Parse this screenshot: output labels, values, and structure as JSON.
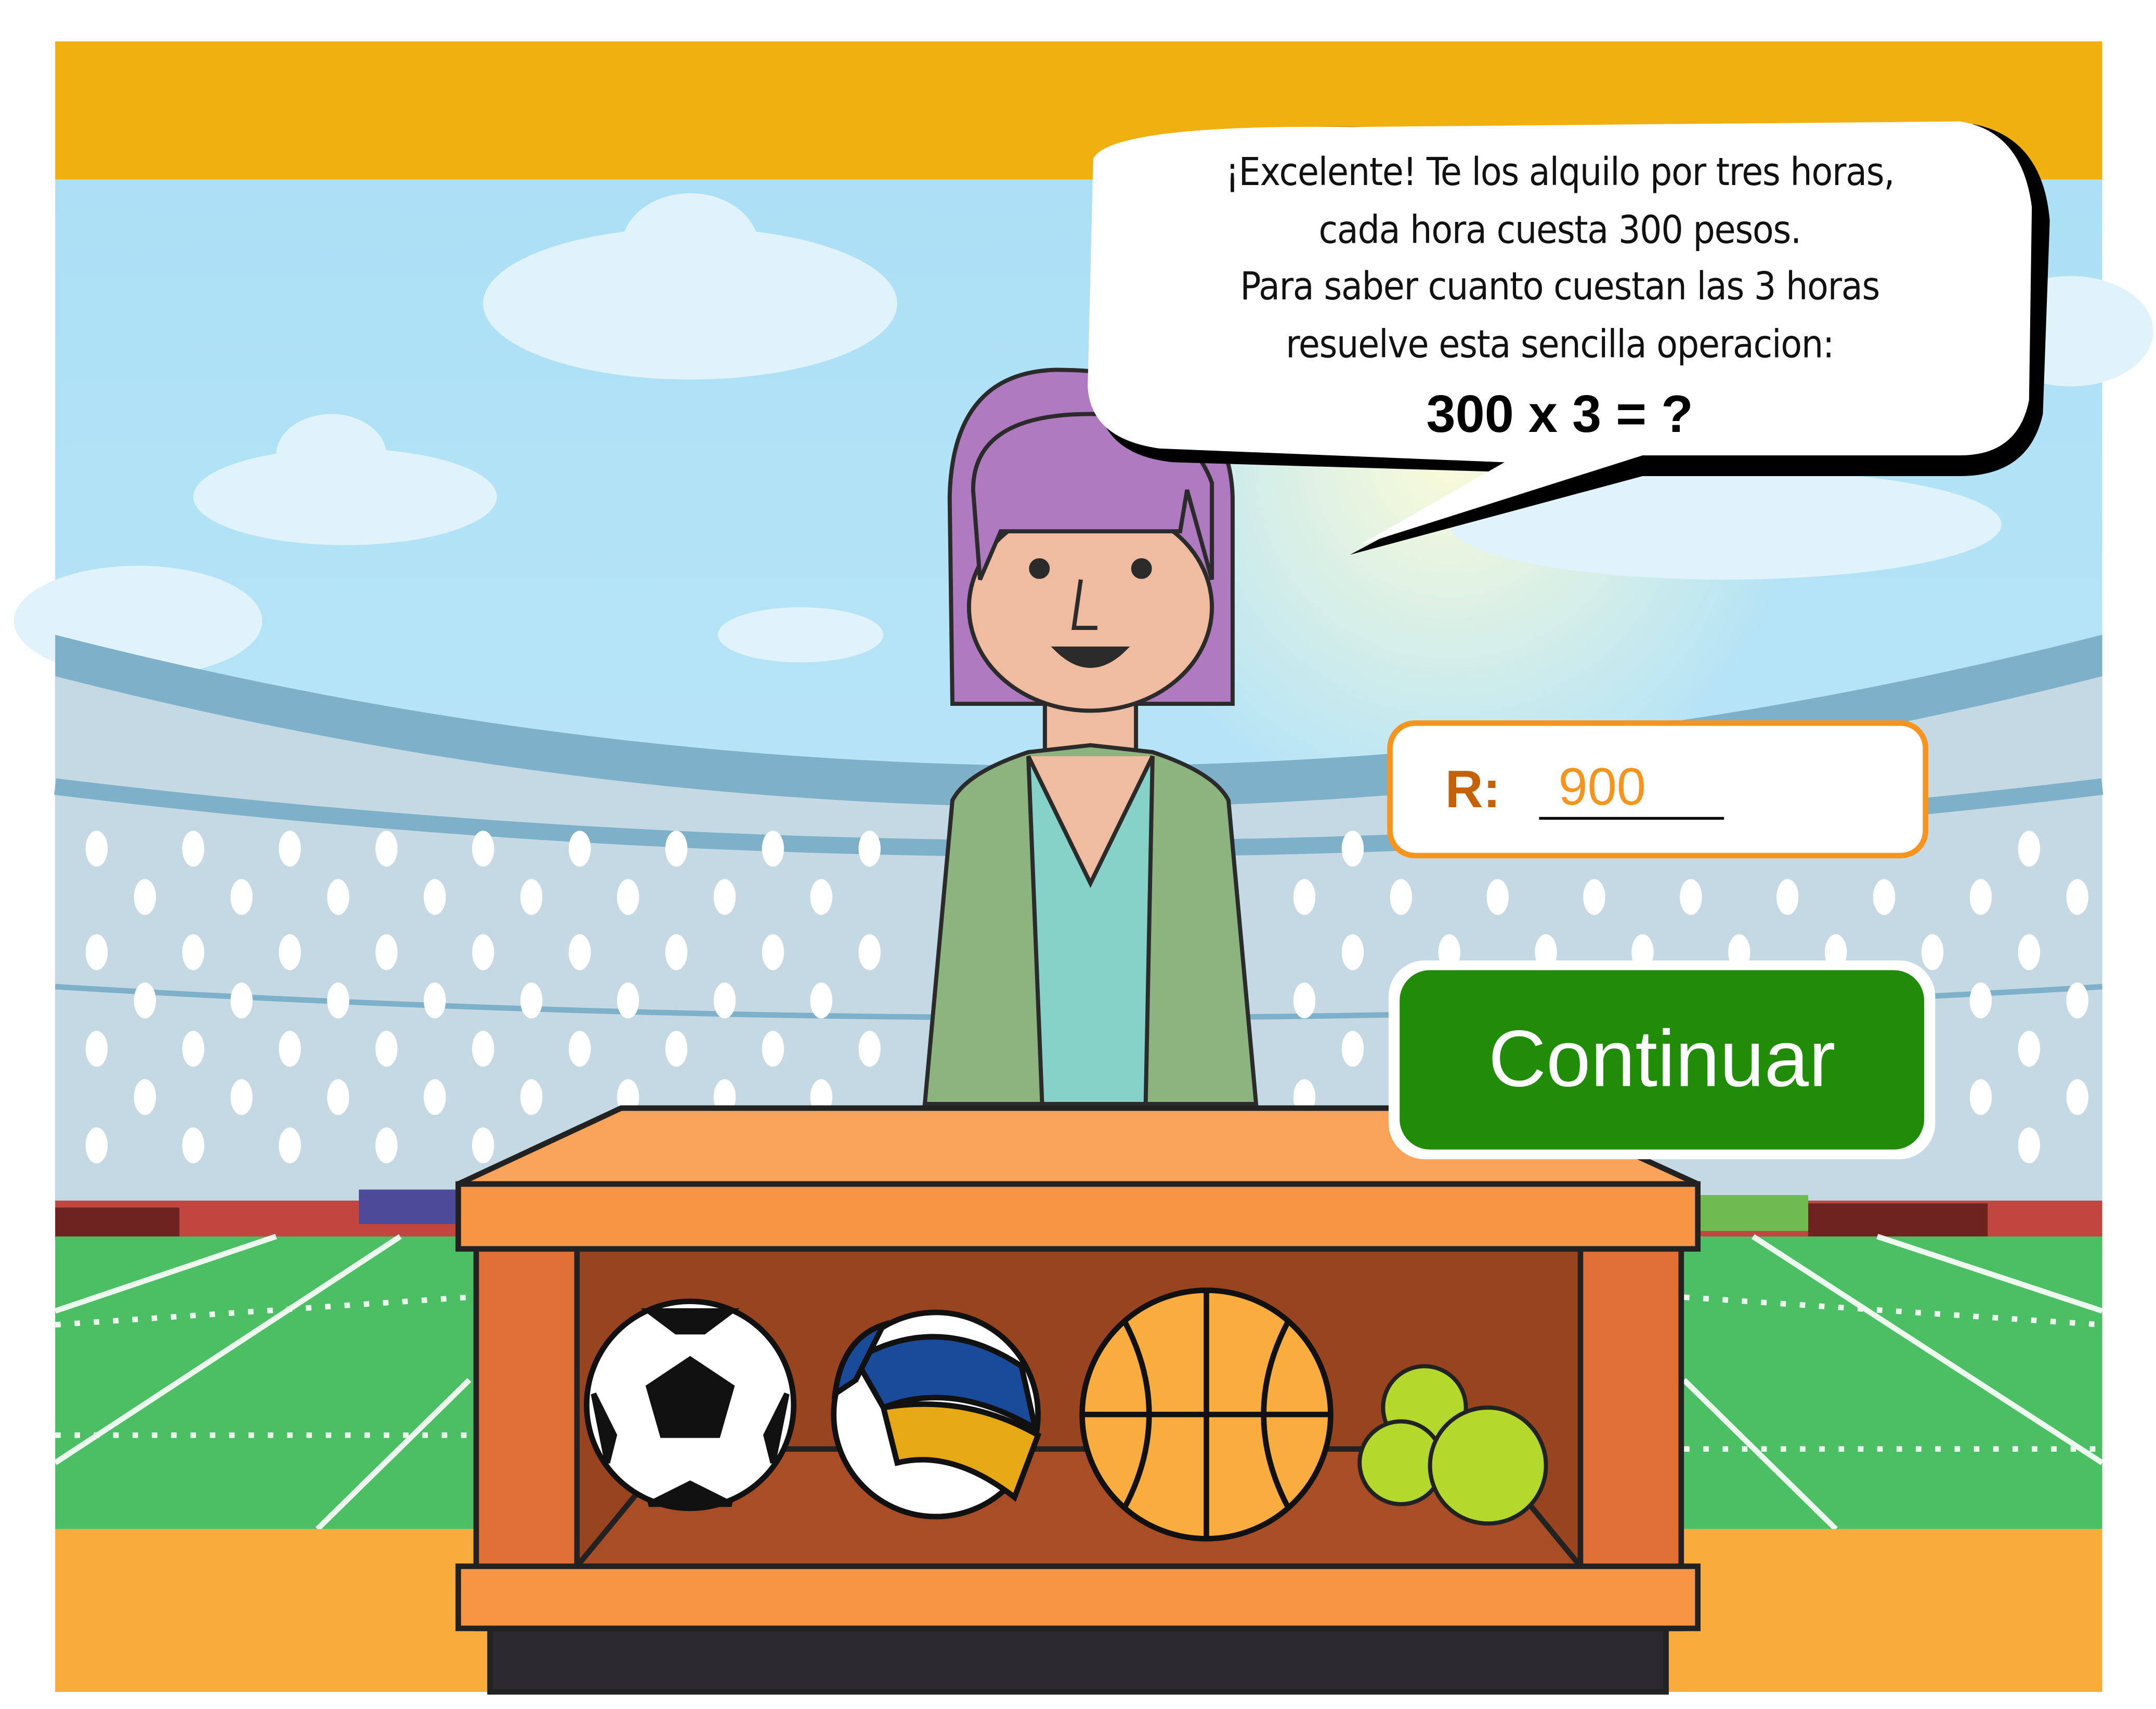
{
  "speech_bubble": {
    "lines": [
      "¡Excelente! Te los alquilo por tres horas,",
      "cada hora cuesta 300 pesos.",
      "Para saber cuanto cuestan las 3 horas",
      "resuelve esta sencilla operacion:"
    ],
    "equation": "300 x 3 = ?"
  },
  "answer": {
    "label": "R:",
    "value": "900"
  },
  "continue_button": {
    "label": "Continuar"
  },
  "colors": {
    "top_bar": "#f0b010",
    "button": "#218c07",
    "answer_border": "#f7941d",
    "answer_text": "#f7941d",
    "hair": "#b07ac1"
  }
}
